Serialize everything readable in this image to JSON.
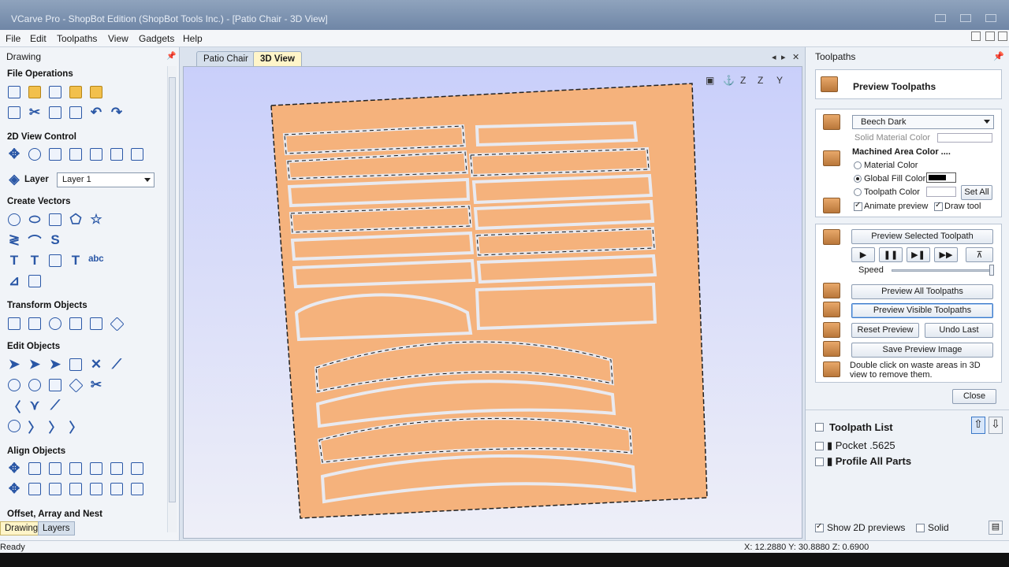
{
  "window": {
    "title": "VCarve Pro - ShopBot Edition (ShopBot Tools Inc.) - [Patio Chair - 3D View]"
  },
  "menu": [
    "File",
    "Edit",
    "Toolpaths",
    "View",
    "Gadgets",
    "Help"
  ],
  "left_panel": {
    "title": "Drawing",
    "sections": {
      "file_ops": "File Operations",
      "view2d": "2D View Control",
      "layer": "Layer",
      "create_vectors": "Create Vectors",
      "transform": "Transform Objects",
      "edit": "Edit Objects",
      "align": "Align Objects",
      "offset": "Offset, Array and Nest"
    },
    "layer_value": "Layer 1",
    "bottom_tabs": [
      "Drawing",
      "Layers"
    ]
  },
  "doc_tabs": [
    "Patio Chair",
    "3D View"
  ],
  "right_panel": {
    "title": "Toolpaths",
    "preview_title": "Preview Toolpaths",
    "material": "Beech Dark",
    "solid_material_color": "Solid Material Color",
    "machined_area": "Machined Area Color ....",
    "material_color": "Material Color",
    "global_fill": "Global Fill Color",
    "toolpath_color": "Toolpath Color",
    "set_all": "Set All",
    "animate_preview": "Animate preview",
    "draw_tool": "Draw tool",
    "preview_selected": "Preview Selected Toolpath",
    "speed": "Speed",
    "preview_all": "Preview All Toolpaths",
    "preview_visible": "Preview Visible Toolpaths",
    "reset_preview": "Reset Preview",
    "undo_last": "Undo Last",
    "save_preview": "Save Preview Image",
    "hint": "Double click on waste areas in 3D view to remove them.",
    "close": "Close",
    "toolpath_list_title": "Toolpath List",
    "toolpaths": [
      "Pocket .5625",
      "Profile All Parts"
    ],
    "show_2d": "Show 2D previews",
    "solid": "Solid"
  },
  "status": {
    "left": "Ready",
    "coords": "X: 12.2880 Y: 30.8880 Z: 0.6900"
  },
  "colors": {
    "material": "#f5b27c",
    "viewbg": "#c9cffa",
    "accent": "#3a78c8"
  }
}
